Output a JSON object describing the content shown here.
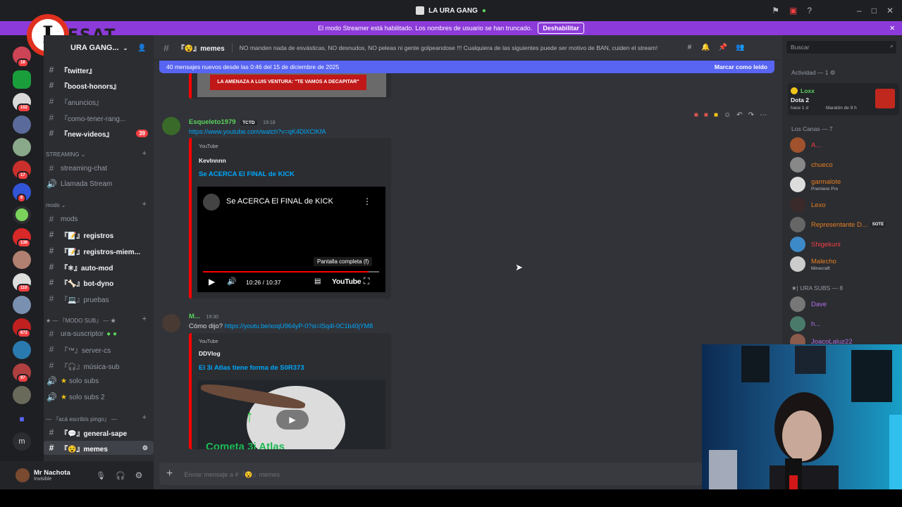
{
  "window": {
    "title": "LA URA GANG"
  },
  "banner": {
    "text": "El modo Streamer está habilitado. Los nombres de usuario se han truncado.",
    "button": "Deshabilitar"
  },
  "logo": {
    "letter": "I",
    "text": "ESAT"
  },
  "rail_badges": [
    "18",
    "102",
    "17",
    "6",
    "136",
    "110",
    "672",
    "97"
  ],
  "server": {
    "name": "URA GANG..."
  },
  "channels": {
    "top": [
      {
        "label": "『twitter』"
      },
      {
        "label": "『boost-honors』"
      },
      {
        "label": "『anuncios』"
      },
      {
        "label": "『como-tener-rang..."
      },
      {
        "label": "『new-videos』",
        "count": "39"
      }
    ],
    "streaming_cat": "STREAMING",
    "streaming": [
      {
        "label": "streaming-chat"
      },
      {
        "label": "Llamada Stream"
      }
    ],
    "mods_cat": "mods",
    "mods": [
      {
        "label": "mods"
      },
      {
        "label": "『📝』registros"
      },
      {
        "label": "『📝』registros-miem..."
      },
      {
        "label": "『⚛』auto-mod"
      },
      {
        "label": "『🦴』bot-dyno"
      },
      {
        "label": "『💻』pruebas"
      }
    ],
    "modo_cat": "『MODO SUB』",
    "modo": [
      {
        "label": "ura-suscriptor"
      },
      {
        "label": "『™』server-cs"
      },
      {
        "label": "『🎧』música-sub"
      },
      {
        "label": "solo subs"
      },
      {
        "label": "solo subs 2"
      }
    ],
    "aca_cat": "『acá escribís pingo』",
    "aca": [
      {
        "label": "『💬』general-sape"
      },
      {
        "label": "『😵』memes"
      }
    ]
  },
  "user": {
    "name": "Mr Nachota",
    "status": "Invisible"
  },
  "header": {
    "channel": "『😵』memes",
    "topic": "NO manden nada de esvásticas, NO desnudos, NO peleas ni gente golpeandose !!! Cualquiera de las siguientes puede ser motivo de BAN, cuiden el stream!"
  },
  "newbar": {
    "text": "40 mensajes nuevos desde las 0:46 del 15 de diciembre de 2025",
    "action": "Marcar como leído"
  },
  "top_image_text": "LA AMENAZA A LUIS VENTURA: \"TE VAMOS A DECAPITAR\"",
  "messages": [
    {
      "author": "Esqueleto1979",
      "tag": "TCTD",
      "time": "19:18",
      "link": "https://www.youtube.com/watch?v=qK4DlXClKfA",
      "embed": {
        "provider": "YouTube",
        "author": "Kevlnnnn",
        "title": "Se ACERCA El FINAL de KICK",
        "video_title": "Se ACERCA El FINAL de KICK",
        "tooltip": "Pantalla completa (f)",
        "time": "10:26 / 10:37",
        "brand": "YouTube",
        "progress": 0.94
      }
    },
    {
      "author": "M...",
      "time": "19:30",
      "text": "Cómo dijo?",
      "link": "https://youtu.be/xoqU964yP-0?si=lSq4l-0C1b40jYM8",
      "embed": {
        "provider": "YouTube",
        "author": "DDVlog",
        "title": "El 3i Atlas tiene forma de S0R373",
        "thumb_text": "Cometa 3i Atlas"
      }
    }
  ],
  "composer": {
    "placeholder": "Enviar mensaje a #『😵』memes"
  },
  "members": {
    "search_placeholder": "Buscar",
    "activity_cat": "Actividad — 1",
    "activity": {
      "name": "Loxx",
      "game": "Dota 2",
      "detail": "hace 1 d",
      "detail2": "Maratón de 9 h"
    },
    "canas_cat": "Los Canas — 7",
    "canas": [
      {
        "name": "A...",
        "color": "#f23f43"
      },
      {
        "name": "chueco",
        "color": "#e67e22"
      },
      {
        "name": "garmalote",
        "color": "#e67e22",
        "sub": "Premiere Pro"
      },
      {
        "name": "Lexo",
        "color": "#e67e22"
      },
      {
        "name": "Representante D...",
        "color": "#e67e22",
        "badge": "SOTE"
      },
      {
        "name": "Shigekuni",
        "color": "#f23f43"
      },
      {
        "name": "Malecho",
        "color": "#e67e22",
        "sub": "Minecraft"
      }
    ],
    "subs_cat": "| URA SUBS — 8",
    "subs": [
      {
        "name": "Dave",
        "color": "#b070e8"
      },
      {
        "name": "h...",
        "color": "#b070e8"
      },
      {
        "name": "JoacoLaluz22",
        "color": "#b070e8"
      }
    ]
  },
  "colors": {
    "accent": "#5865f2",
    "streamer": "#8c3ad9",
    "youtube_red": "#ff0000",
    "link": "#00a8fc"
  }
}
